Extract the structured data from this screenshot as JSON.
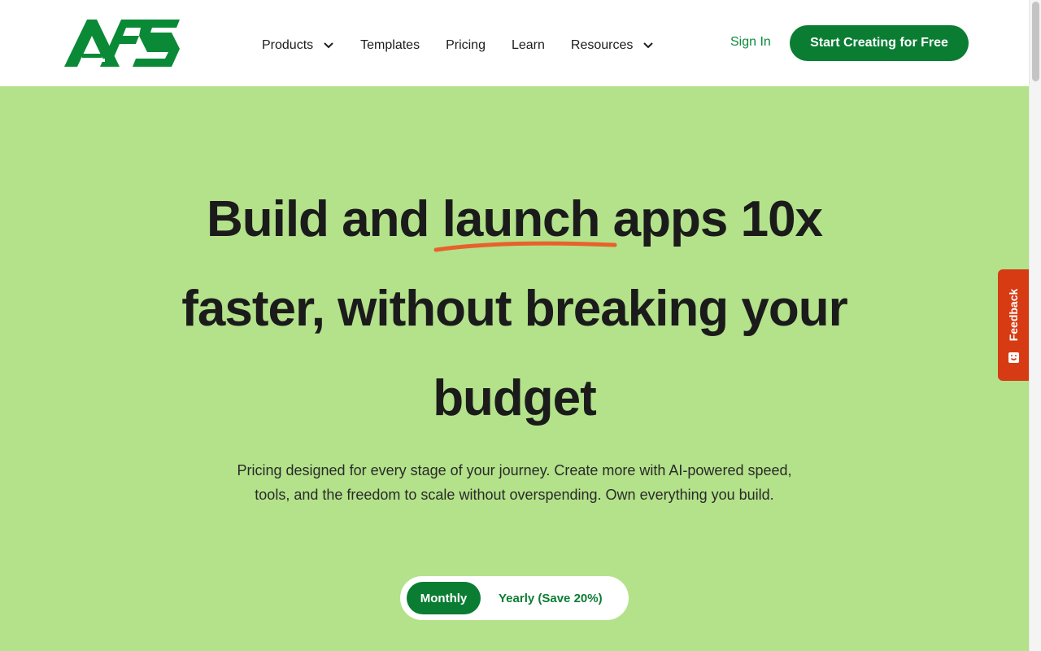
{
  "header": {
    "logo_text": "AFS",
    "nav": [
      {
        "label": "Products",
        "has_dropdown": true
      },
      {
        "label": "Templates",
        "has_dropdown": false
      },
      {
        "label": "Pricing",
        "has_dropdown": false
      },
      {
        "label": "Learn",
        "has_dropdown": false
      },
      {
        "label": "Resources",
        "has_dropdown": true
      }
    ],
    "sign_in": "Sign In",
    "cta": "Start Creating for Free"
  },
  "hero": {
    "title_part1": "Build and",
    "title_highlight": "launch",
    "title_part2": "apps 10x faster, without breaking your budget",
    "subtitle": "Pricing designed for every stage of your journey. Create more with AI-powered speed, tools, and the freedom to scale without overspending. Own everything you build."
  },
  "billing_toggle": {
    "monthly": "Monthly",
    "yearly": "Yearly (Save 20%)",
    "selected": "Monthly"
  },
  "feedback": {
    "label": "Feedback"
  },
  "colors": {
    "brand_green": "#0a7d33",
    "hero_bg": "#b3e28a",
    "accent_orange": "#e8612c",
    "feedback_red": "#d63b14"
  }
}
